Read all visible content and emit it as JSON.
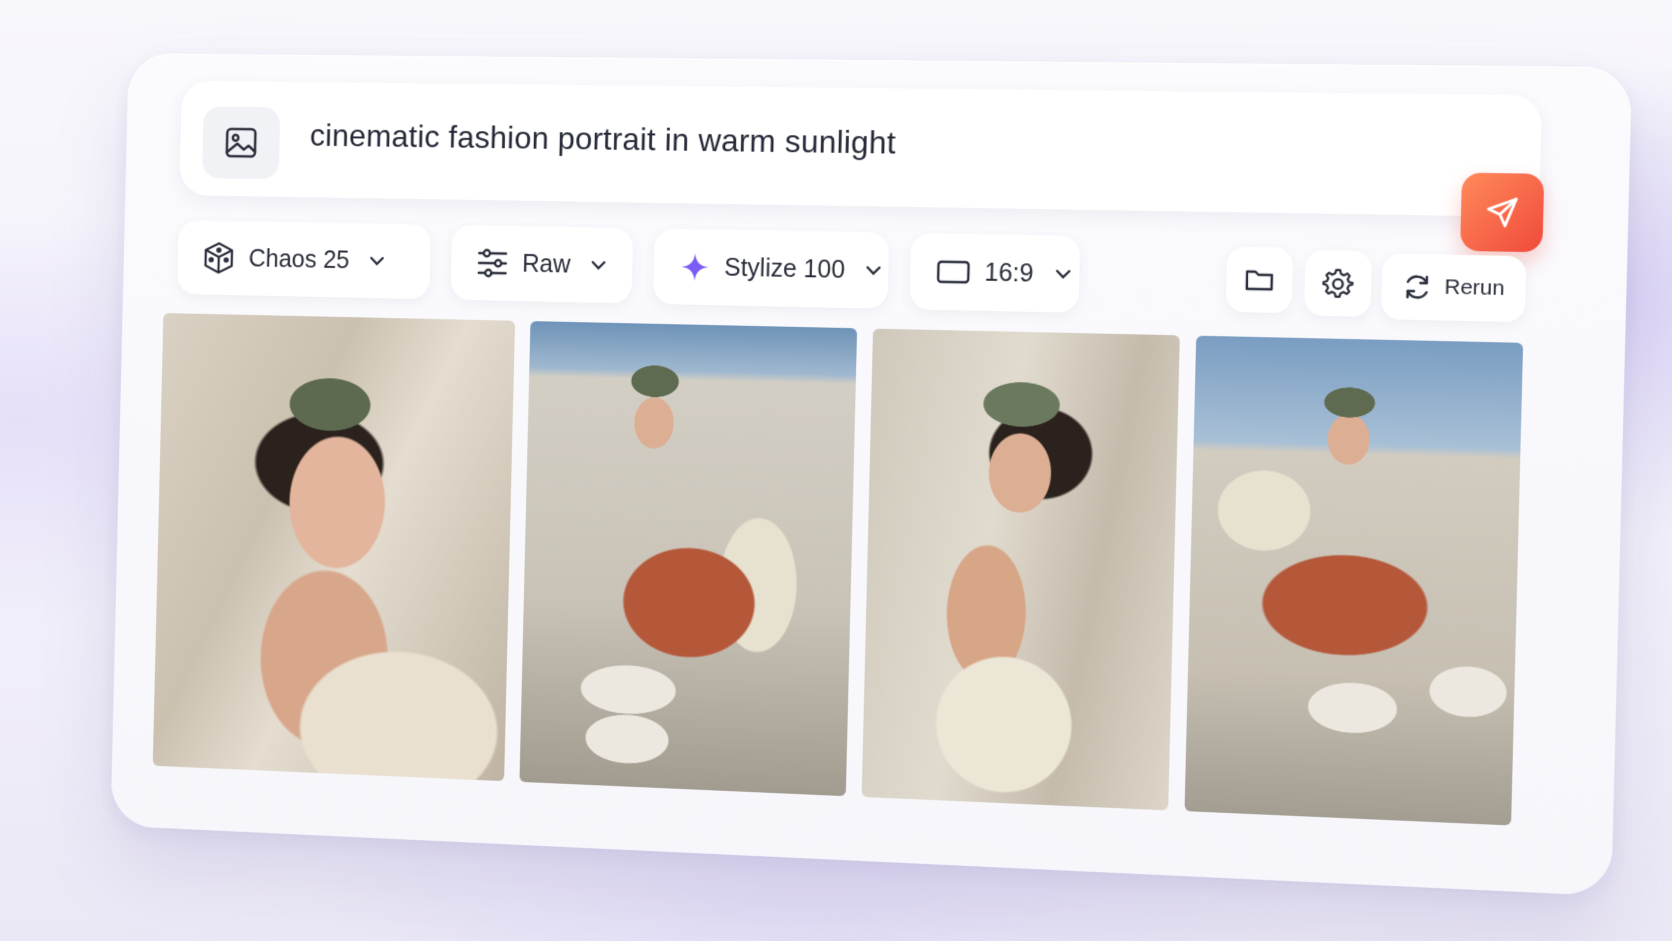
{
  "prompt": {
    "text": "cinematic fashion portrait in warm sunlight",
    "image_icon": "image-icon",
    "send_icon": "send-icon",
    "send_color": "#f25a40"
  },
  "toolbar": {
    "chaos": {
      "label": "Chaos 25",
      "icon": "dice-cube-icon"
    },
    "raw": {
      "label": "Raw",
      "icon": "sliders-icon"
    },
    "stylize": {
      "label": "Stylize 100",
      "icon": "sparkle-icon",
      "icon_color": "#7b5cf5"
    },
    "aspect": {
      "label": "16:9",
      "icon": "aspect-ratio-icon"
    },
    "folder_icon": "folder-icon",
    "settings_icon": "gear-icon",
    "rerun": {
      "label": "Rerun",
      "icon": "refresh-icon"
    }
  },
  "results": [
    {
      "name": "result-image-1",
      "description": "close-up portrait, green cap"
    },
    {
      "name": "result-image-2",
      "description": "sitting on steps, rust pants"
    },
    {
      "name": "result-image-3",
      "description": "over-shoulder portrait, green cap"
    },
    {
      "name": "result-image-4",
      "description": "sitting, hand on cap, rust pants"
    }
  ]
}
